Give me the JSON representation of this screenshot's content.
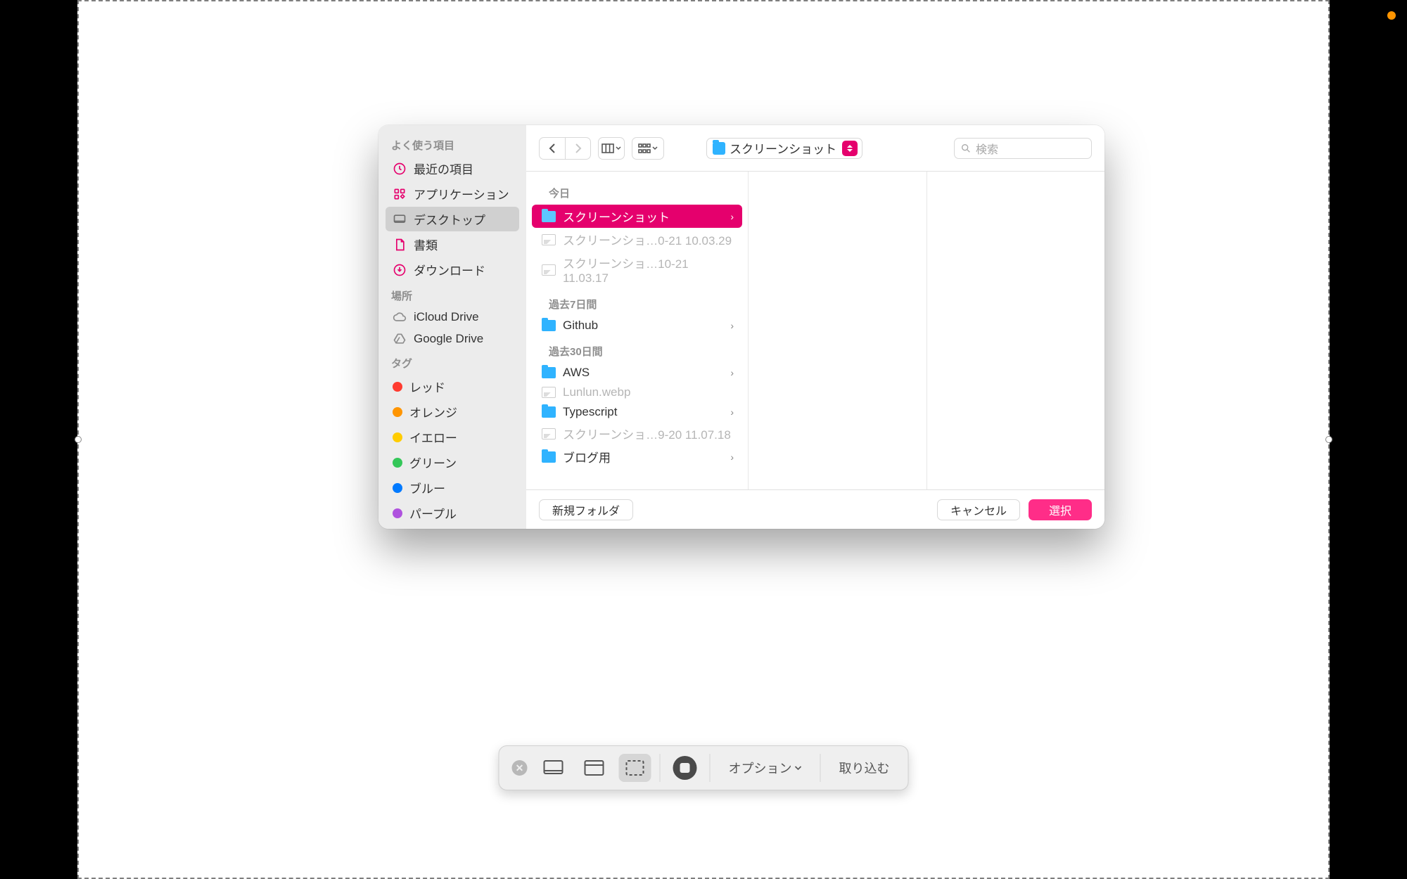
{
  "colors": {
    "accent": "#e5006d",
    "accent_light": "#ff2d88"
  },
  "sidebar": {
    "favorites_header": "よく使う項目",
    "favorites": [
      {
        "id": "recents",
        "label": "最近の項目",
        "icon": "clock-icon",
        "accent": true
      },
      {
        "id": "applications",
        "label": "アプリケーション",
        "icon": "app-grid-icon",
        "accent": true
      },
      {
        "id": "desktop",
        "label": "デスクトップ",
        "icon": "desktop-icon",
        "selected": true
      },
      {
        "id": "documents",
        "label": "書類",
        "icon": "document-icon",
        "accent": true
      },
      {
        "id": "downloads",
        "label": "ダウンロード",
        "icon": "download-icon",
        "accent": true
      }
    ],
    "locations_header": "場所",
    "locations": [
      {
        "id": "icloud",
        "label": "iCloud Drive",
        "icon": "cloud-icon"
      },
      {
        "id": "gdrive",
        "label": "Google Drive",
        "icon": "gdrive-icon"
      }
    ],
    "tags_header": "タグ",
    "tags": [
      {
        "label": "レッド",
        "color": "#ff3b30"
      },
      {
        "label": "オレンジ",
        "color": "#ff9500"
      },
      {
        "label": "イエロー",
        "color": "#ffcc00"
      },
      {
        "label": "グリーン",
        "color": "#34c759"
      },
      {
        "label": "ブルー",
        "color": "#007aff"
      },
      {
        "label": "パープル",
        "color": "#af52de"
      }
    ]
  },
  "toolbar": {
    "path_label": "スクリーンショット",
    "search_placeholder": "検索"
  },
  "column1": {
    "groups": [
      {
        "header": "今日",
        "items": [
          {
            "type": "folder",
            "label": "スクリーンショット",
            "selected": true,
            "chevron": true
          },
          {
            "type": "image",
            "label": "スクリーンショ…0-21 10.03.29",
            "dim": true
          },
          {
            "type": "image",
            "label": "スクリーンショ…10-21 11.03.17",
            "dim": true
          }
        ]
      },
      {
        "header": "過去7日間",
        "items": [
          {
            "type": "folder",
            "label": "Github",
            "chevron": true
          }
        ]
      },
      {
        "header": "過去30日間",
        "items": [
          {
            "type": "folder",
            "label": "AWS",
            "chevron": true
          },
          {
            "type": "image",
            "label": "Lunlun.webp",
            "dim": true
          },
          {
            "type": "folder",
            "label": "Typescript",
            "chevron": true
          },
          {
            "type": "image",
            "label": "スクリーンショ…9-20 11.07.18",
            "dim": true
          },
          {
            "type": "folder",
            "label": "ブログ用",
            "chevron": true
          }
        ]
      }
    ]
  },
  "footer": {
    "new_folder": "新規フォルダ",
    "cancel": "キャンセル",
    "choose": "選択"
  },
  "screenshot_bar": {
    "options": "オプション",
    "capture": "取り込む"
  }
}
